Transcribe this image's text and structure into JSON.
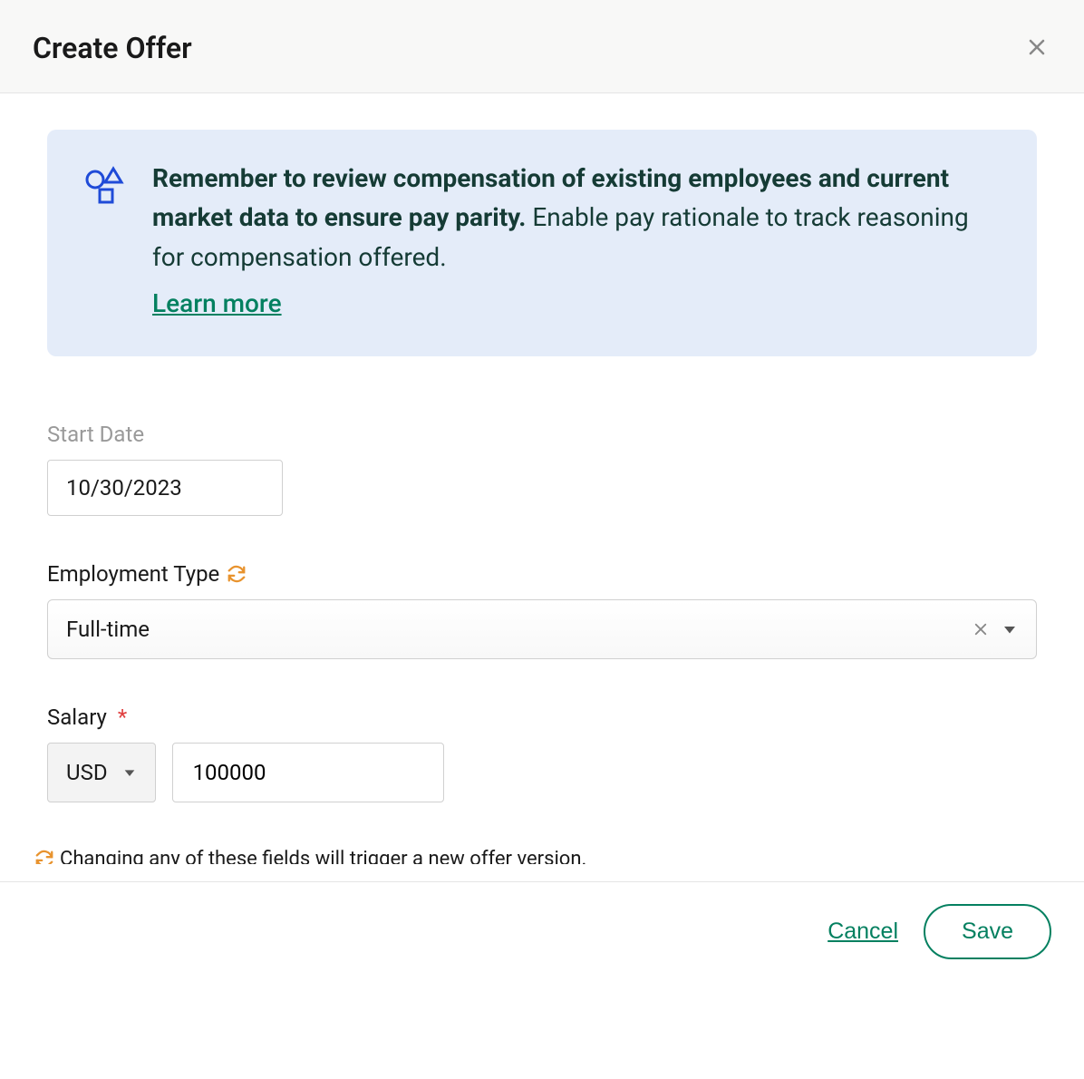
{
  "header": {
    "title": "Create Offer"
  },
  "banner": {
    "bold_text": "Remember to review compensation of existing employees and current market data to ensure pay parity.",
    "normal_text": "Enable pay rationale to track reasoning for compensation offered.",
    "link_text": "Learn more"
  },
  "fields": {
    "start_date": {
      "label": "Start Date",
      "value": "10/30/2023"
    },
    "employment_type": {
      "label": "Employment Type",
      "value": "Full-time"
    },
    "salary": {
      "label": "Salary",
      "currency": "USD",
      "amount": "100000"
    }
  },
  "version_note": "Changing any of these fields will trigger a new offer version.",
  "footer": {
    "cancel": "Cancel",
    "save": "Save"
  }
}
